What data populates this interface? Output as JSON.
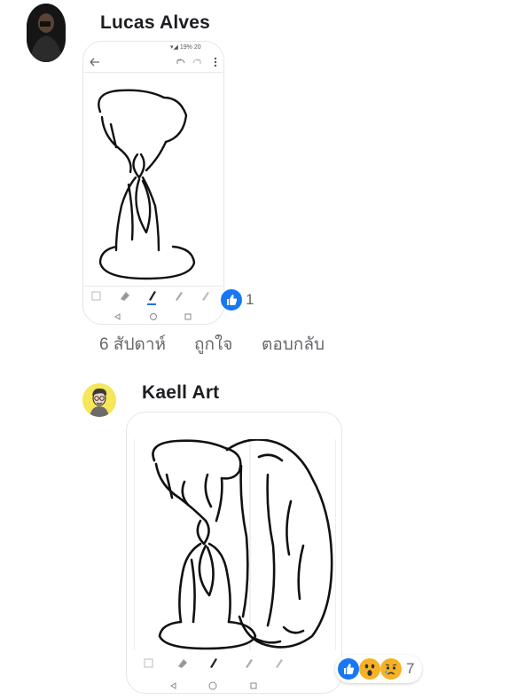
{
  "comments": [
    {
      "author": "Lucas Alves",
      "status_bar": "19% 20",
      "reaction_count": "1",
      "actions": {
        "time": "6 สัปดาห์",
        "like": "ถูกใจ",
        "reply": "ตอบกลับ"
      }
    },
    {
      "author": "Kaell Art",
      "reaction_count": "7"
    }
  ],
  "colors": {
    "like_blue": "#1877f2",
    "wow_yellow": "#f7b125",
    "muted": "#65676b"
  },
  "icons": [
    "back-arrow-icon",
    "undo-icon",
    "redo-icon",
    "more-icon",
    "eraser-icon",
    "pen-icon",
    "pencil-icon",
    "brush-icon",
    "nav-back-icon",
    "nav-home-icon",
    "nav-recents-icon",
    "like-reaction-icon",
    "wow-reaction-icon",
    "sad-reaction-icon"
  ]
}
